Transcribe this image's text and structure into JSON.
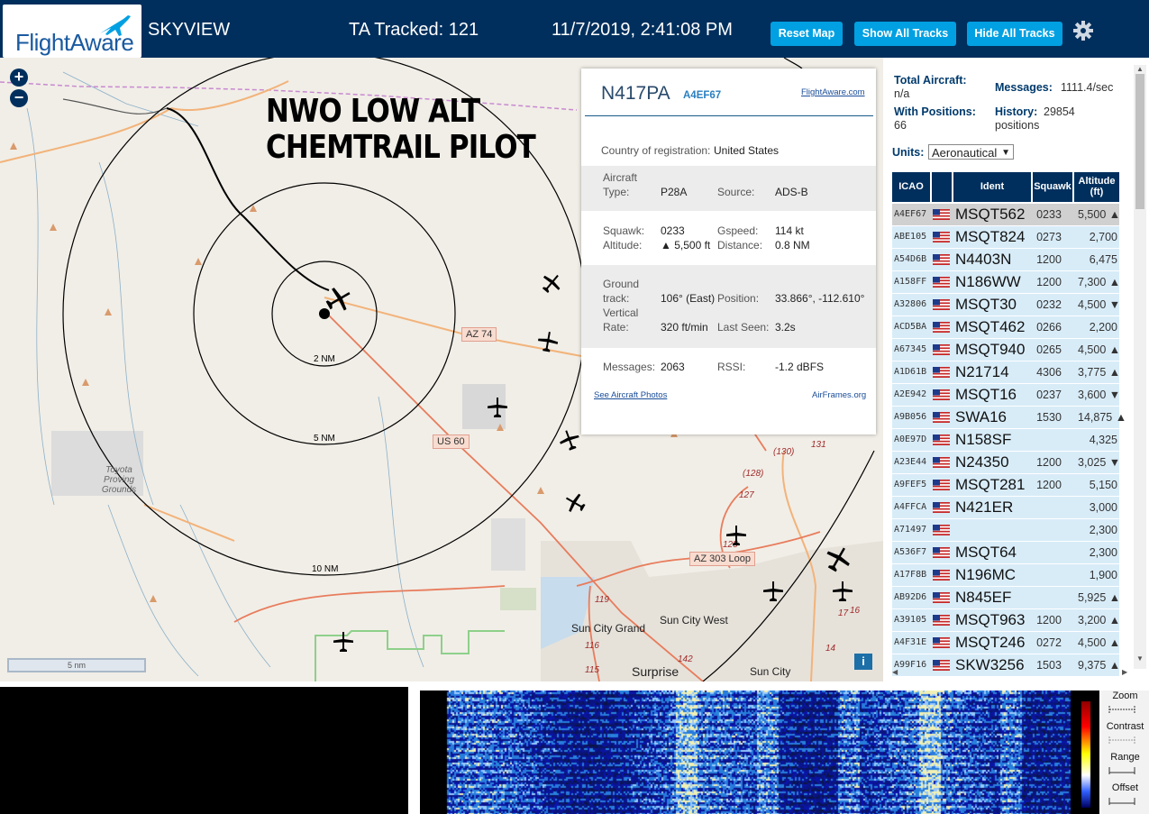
{
  "header": {
    "logo_text": "FlightAware",
    "site": "SKYVIEW",
    "tracked_label": "TA Tracked: 121",
    "datetime": "11/7/2019, 2:41:08 PM",
    "buttons": [
      "Reset Map",
      "Show All Tracks",
      "Hide All Tracks"
    ],
    "gear_icon": "gear-icon"
  },
  "map": {
    "zoom_in": "+",
    "zoom_out": "−",
    "overlay_lines": [
      "NWO LOW ALT",
      "CHEMTRAIL PILOT"
    ],
    "rings": [
      "2 NM",
      "5 NM",
      "10 NM"
    ],
    "shields": [
      "AZ 74",
      "US 60",
      "AZ 303 Loop"
    ],
    "road_numbers": [
      "(130)",
      "131",
      "(128)",
      "127",
      "125",
      "119",
      "116",
      "115",
      "142",
      "14",
      "16",
      "17"
    ],
    "towns": [
      "Toyota Proving Grounds",
      "Sun City Grand",
      "Sun City West",
      "Surprise",
      "Sun City"
    ],
    "scale": "5 nm",
    "info_button": "i",
    "colors": {
      "land": "#f1eee7",
      "road": "#e87c5c",
      "range_ring": "#000000",
      "track": "#000000"
    }
  },
  "popup": {
    "registration": "N417PA",
    "icao": "A4EF67",
    "flightaware_link": "FlightAware.com",
    "country_label": "Country of registration:",
    "country": "United States",
    "type_label1": "Aircraft",
    "type_label2": "Type:",
    "type": "P28A",
    "source_label": "Source:",
    "source": "ADS-B",
    "squawk_label": "Squawk:",
    "squawk": "0233",
    "gspeed_label": "Gspeed:",
    "gspeed": "114 kt",
    "altitude_label": "Altitude:",
    "altitude": "▲ 5,500 ft",
    "distance_label": "Distance:",
    "distance": "0.8 NM",
    "track_label1": "Ground",
    "track_label2": "track:",
    "track": "106° (East)",
    "position_label": "Position:",
    "position": "33.866°, -112.610°",
    "vrate_label1": "Vertical",
    "vrate_label2": "Rate:",
    "vrate": "320 ft/min",
    "lastseen_label": "Last Seen:",
    "lastseen": "3.2s",
    "messages_label": "Messages:",
    "messages": "2063",
    "rssi_label": "RSSI:",
    "rssi": "-1.2 dBFS",
    "photos_link": "See Aircraft Photos",
    "airframes_link": "AirFrames.org"
  },
  "sidebar": {
    "total_label": "Total Aircraft:",
    "total_value": "n/a",
    "messages_label": "Messages:",
    "messages_value": "1111.4/sec",
    "withpos_label": "With Positions:",
    "withpos_value": "66",
    "history_label": "History:",
    "history_value": "29854",
    "history_unit": "positions",
    "units_label": "Units:",
    "units_value": "Aeronautical",
    "columns": [
      "ICAO",
      "",
      "Ident",
      "Squawk",
      "Altitude (ft)"
    ],
    "rows": [
      {
        "icao": "A4EF67",
        "ident": "MSQT562",
        "squawk": "0233",
        "alt": "5,500 ▲"
      },
      {
        "icao": "ABE105",
        "ident": "MSQT824",
        "squawk": "0273",
        "alt": "2,700"
      },
      {
        "icao": "A54D6B",
        "ident": "N4403N",
        "squawk": "1200",
        "alt": "6,475"
      },
      {
        "icao": "A158FF",
        "ident": "N186WW",
        "squawk": "1200",
        "alt": "7,300 ▲"
      },
      {
        "icao": "A32806",
        "ident": "MSQT30",
        "squawk": "0232",
        "alt": "4,500 ▼"
      },
      {
        "icao": "ACD5BA",
        "ident": "MSQT462",
        "squawk": "0266",
        "alt": "2,200"
      },
      {
        "icao": "A67345",
        "ident": "MSQT940",
        "squawk": "0265",
        "alt": "4,500 ▲"
      },
      {
        "icao": "A1D61B",
        "ident": "N21714",
        "squawk": "4306",
        "alt": "3,775 ▲"
      },
      {
        "icao": "A2E942",
        "ident": "MSQT16",
        "squawk": "0237",
        "alt": "3,600 ▼"
      },
      {
        "icao": "A9B056",
        "ident": "SWA16",
        "squawk": "1530",
        "alt": "14,875 ▲"
      },
      {
        "icao": "A0E97D",
        "ident": "N158SF",
        "squawk": "",
        "alt": "4,325"
      },
      {
        "icao": "A23E44",
        "ident": "N24350",
        "squawk": "1200",
        "alt": "3,025 ▼"
      },
      {
        "icao": "A9FEF5",
        "ident": "MSQT281",
        "squawk": "1200",
        "alt": "5,150"
      },
      {
        "icao": "A4FFCA",
        "ident": "N421ER",
        "squawk": "",
        "alt": "3,000"
      },
      {
        "icao": "A71497",
        "ident": "",
        "squawk": "",
        "alt": "2,300"
      },
      {
        "icao": "A536F7",
        "ident": "MSQT64",
        "squawk": "",
        "alt": "2,300"
      },
      {
        "icao": "A17F8B",
        "ident": "N196MC",
        "squawk": "",
        "alt": "1,900"
      },
      {
        "icao": "AB92D6",
        "ident": "N845EF",
        "squawk": "",
        "alt": "5,925 ▲"
      },
      {
        "icao": "A39105",
        "ident": "MSQT963",
        "squawk": "1200",
        "alt": "3,200 ▲"
      },
      {
        "icao": "A4F31E",
        "ident": "MSQT246",
        "squawk": "0272",
        "alt": "4,500 ▲"
      },
      {
        "icao": "A99F16",
        "ident": "SKW3256",
        "squawk": "1503",
        "alt": "9,375 ▲"
      }
    ]
  },
  "waterfall": {
    "controls": [
      "Zoom",
      "Contrast",
      "Range",
      "Offset"
    ]
  }
}
